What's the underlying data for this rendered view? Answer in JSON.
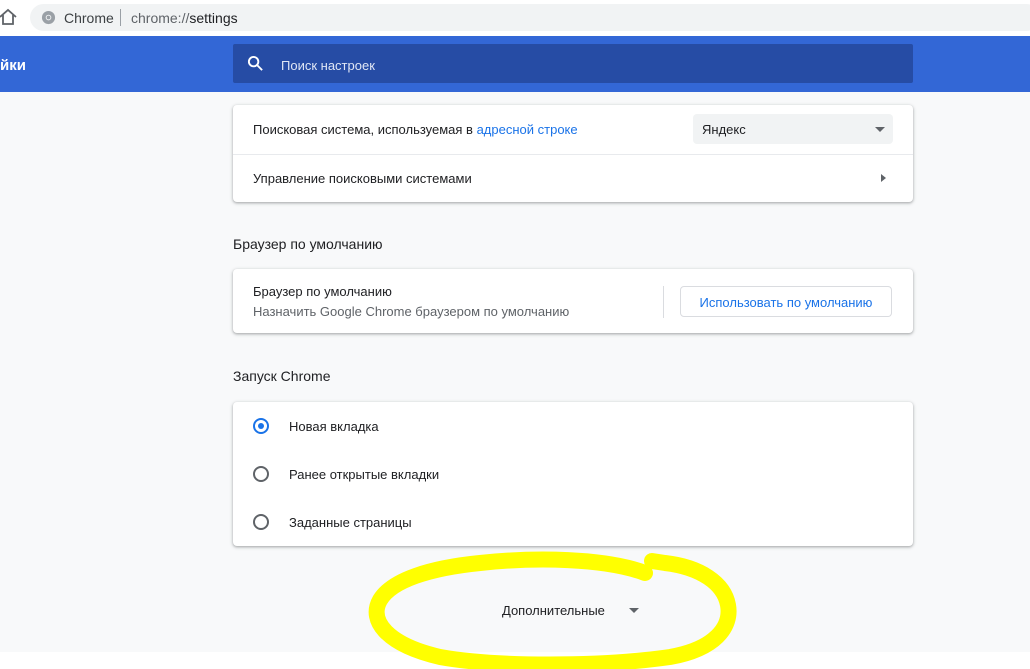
{
  "browser": {
    "omnibox_site_name": "Chrome",
    "omnibox_url_scheme": "chrome://",
    "omnibox_url_path": "settings"
  },
  "header": {
    "title": "йки",
    "search_placeholder": "Поиск настроек",
    "accent_color": "#3367d6"
  },
  "search_engine_card": {
    "engine_label_prefix": "Поисковая система, используемая в ",
    "engine_label_link": "адресной строке",
    "engine_select_value": "Яндекс",
    "manage_label": "Управление поисковыми системами"
  },
  "default_browser": {
    "section_title": "Браузер по умолчанию",
    "row_title": "Браузер по умолчанию",
    "row_subtitle": "Назначить Google Chrome браузером по умолчанию",
    "button_label": "Использовать по умолчанию"
  },
  "on_startup": {
    "section_title": "Запуск Chrome",
    "options": [
      {
        "label": "Новая вкладка",
        "selected": true
      },
      {
        "label": "Ранее открытые вкладки",
        "selected": false
      },
      {
        "label": "Заданные страницы",
        "selected": false
      }
    ]
  },
  "advanced": {
    "label": "Дополнительные",
    "highlight_color": "#ffff00"
  },
  "icons": [
    "home-icon",
    "site-info-icon",
    "search-icon",
    "dropdown-arrow-icon",
    "chevron-right-icon",
    "chevron-down-icon"
  ]
}
